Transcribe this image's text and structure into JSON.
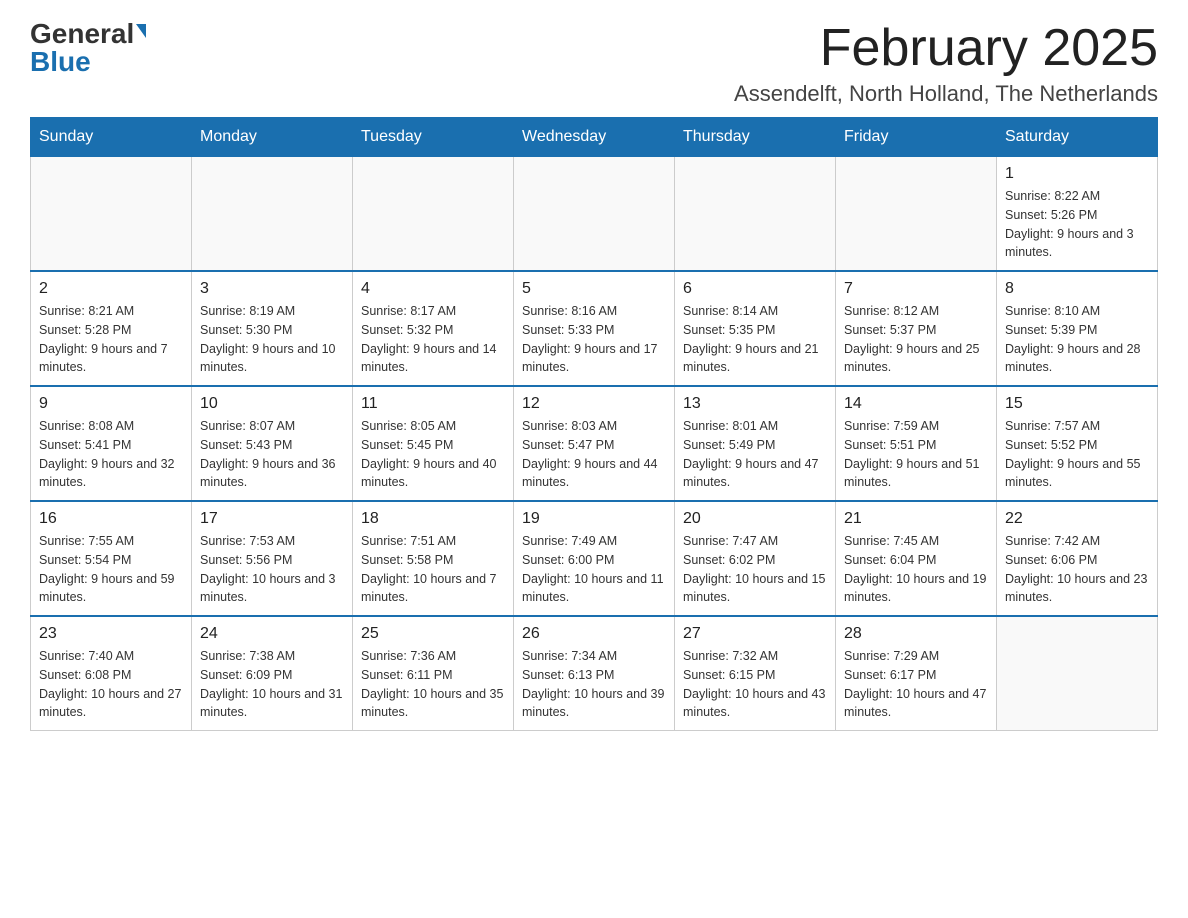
{
  "header": {
    "logo_general": "General",
    "logo_blue": "Blue",
    "title": "February 2025",
    "subtitle": "Assendelft, North Holland, The Netherlands"
  },
  "days_of_week": [
    "Sunday",
    "Monday",
    "Tuesday",
    "Wednesday",
    "Thursday",
    "Friday",
    "Saturday"
  ],
  "weeks": [
    [
      {
        "day": "",
        "info": ""
      },
      {
        "day": "",
        "info": ""
      },
      {
        "day": "",
        "info": ""
      },
      {
        "day": "",
        "info": ""
      },
      {
        "day": "",
        "info": ""
      },
      {
        "day": "",
        "info": ""
      },
      {
        "day": "1",
        "info": "Sunrise: 8:22 AM\nSunset: 5:26 PM\nDaylight: 9 hours and 3 minutes."
      }
    ],
    [
      {
        "day": "2",
        "info": "Sunrise: 8:21 AM\nSunset: 5:28 PM\nDaylight: 9 hours and 7 minutes."
      },
      {
        "day": "3",
        "info": "Sunrise: 8:19 AM\nSunset: 5:30 PM\nDaylight: 9 hours and 10 minutes."
      },
      {
        "day": "4",
        "info": "Sunrise: 8:17 AM\nSunset: 5:32 PM\nDaylight: 9 hours and 14 minutes."
      },
      {
        "day": "5",
        "info": "Sunrise: 8:16 AM\nSunset: 5:33 PM\nDaylight: 9 hours and 17 minutes."
      },
      {
        "day": "6",
        "info": "Sunrise: 8:14 AM\nSunset: 5:35 PM\nDaylight: 9 hours and 21 minutes."
      },
      {
        "day": "7",
        "info": "Sunrise: 8:12 AM\nSunset: 5:37 PM\nDaylight: 9 hours and 25 minutes."
      },
      {
        "day": "8",
        "info": "Sunrise: 8:10 AM\nSunset: 5:39 PM\nDaylight: 9 hours and 28 minutes."
      }
    ],
    [
      {
        "day": "9",
        "info": "Sunrise: 8:08 AM\nSunset: 5:41 PM\nDaylight: 9 hours and 32 minutes."
      },
      {
        "day": "10",
        "info": "Sunrise: 8:07 AM\nSunset: 5:43 PM\nDaylight: 9 hours and 36 minutes."
      },
      {
        "day": "11",
        "info": "Sunrise: 8:05 AM\nSunset: 5:45 PM\nDaylight: 9 hours and 40 minutes."
      },
      {
        "day": "12",
        "info": "Sunrise: 8:03 AM\nSunset: 5:47 PM\nDaylight: 9 hours and 44 minutes."
      },
      {
        "day": "13",
        "info": "Sunrise: 8:01 AM\nSunset: 5:49 PM\nDaylight: 9 hours and 47 minutes."
      },
      {
        "day": "14",
        "info": "Sunrise: 7:59 AM\nSunset: 5:51 PM\nDaylight: 9 hours and 51 minutes."
      },
      {
        "day": "15",
        "info": "Sunrise: 7:57 AM\nSunset: 5:52 PM\nDaylight: 9 hours and 55 minutes."
      }
    ],
    [
      {
        "day": "16",
        "info": "Sunrise: 7:55 AM\nSunset: 5:54 PM\nDaylight: 9 hours and 59 minutes."
      },
      {
        "day": "17",
        "info": "Sunrise: 7:53 AM\nSunset: 5:56 PM\nDaylight: 10 hours and 3 minutes."
      },
      {
        "day": "18",
        "info": "Sunrise: 7:51 AM\nSunset: 5:58 PM\nDaylight: 10 hours and 7 minutes."
      },
      {
        "day": "19",
        "info": "Sunrise: 7:49 AM\nSunset: 6:00 PM\nDaylight: 10 hours and 11 minutes."
      },
      {
        "day": "20",
        "info": "Sunrise: 7:47 AM\nSunset: 6:02 PM\nDaylight: 10 hours and 15 minutes."
      },
      {
        "day": "21",
        "info": "Sunrise: 7:45 AM\nSunset: 6:04 PM\nDaylight: 10 hours and 19 minutes."
      },
      {
        "day": "22",
        "info": "Sunrise: 7:42 AM\nSunset: 6:06 PM\nDaylight: 10 hours and 23 minutes."
      }
    ],
    [
      {
        "day": "23",
        "info": "Sunrise: 7:40 AM\nSunset: 6:08 PM\nDaylight: 10 hours and 27 minutes."
      },
      {
        "day": "24",
        "info": "Sunrise: 7:38 AM\nSunset: 6:09 PM\nDaylight: 10 hours and 31 minutes."
      },
      {
        "day": "25",
        "info": "Sunrise: 7:36 AM\nSunset: 6:11 PM\nDaylight: 10 hours and 35 minutes."
      },
      {
        "day": "26",
        "info": "Sunrise: 7:34 AM\nSunset: 6:13 PM\nDaylight: 10 hours and 39 minutes."
      },
      {
        "day": "27",
        "info": "Sunrise: 7:32 AM\nSunset: 6:15 PM\nDaylight: 10 hours and 43 minutes."
      },
      {
        "day": "28",
        "info": "Sunrise: 7:29 AM\nSunset: 6:17 PM\nDaylight: 10 hours and 47 minutes."
      },
      {
        "day": "",
        "info": ""
      }
    ]
  ]
}
